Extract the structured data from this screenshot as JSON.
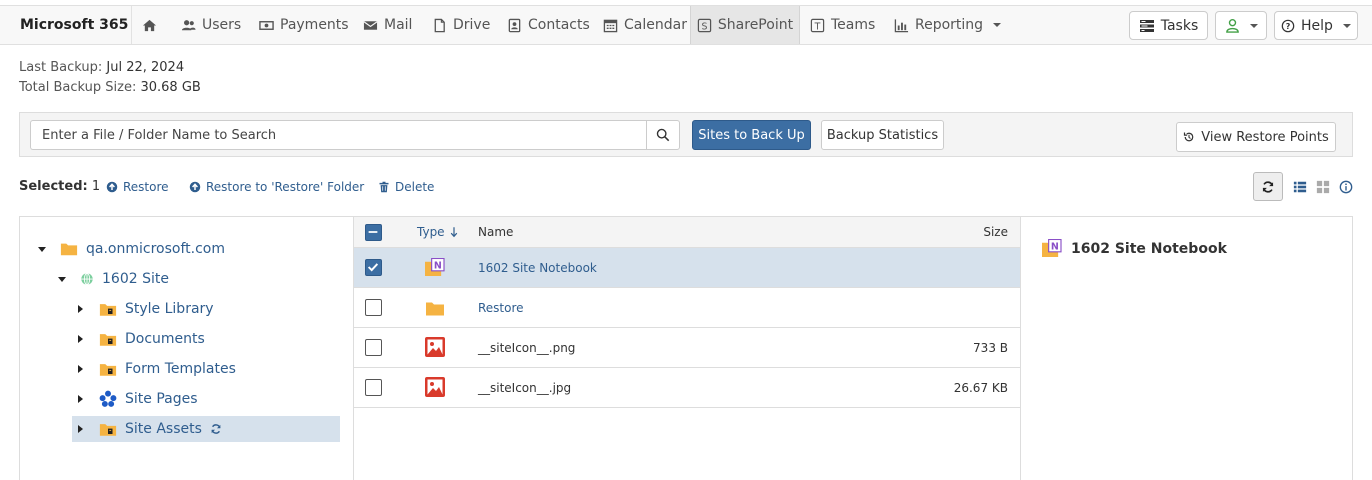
{
  "app": {
    "brand": "Microsoft 365"
  },
  "nav": [
    {
      "label": "",
      "icon": "home-icon"
    },
    {
      "label": "Users",
      "icon": "users-icon"
    },
    {
      "label": "Payments",
      "icon": "payments-icon"
    },
    {
      "label": "Mail",
      "icon": "mail-icon"
    },
    {
      "label": "Drive",
      "icon": "drive-icon"
    },
    {
      "label": "Contacts",
      "icon": "contacts-icon"
    },
    {
      "label": "Calendar",
      "icon": "calendar-icon"
    },
    {
      "label": "SharePoint",
      "icon": "sharepoint-icon",
      "active": true
    },
    {
      "label": "Teams",
      "icon": "teams-icon"
    },
    {
      "label": "Reporting",
      "icon": "reporting-icon"
    }
  ],
  "right_nav": {
    "tasks": "Tasks",
    "help": "Help"
  },
  "backup_info": {
    "last_backup_label": "Last Backup:",
    "last_backup_value": "Jul 22, 2024",
    "total_size_label": "Total Backup Size:",
    "total_size_value": "30.68 GB"
  },
  "search": {
    "placeholder": "Enter a File / Folder Name to Search",
    "value": ""
  },
  "buttons": {
    "sites_to_back_up": "Sites to Back Up",
    "backup_statistics": "Backup Statistics",
    "view_restore_points": "View Restore Points"
  },
  "actions": {
    "selected_label": "Selected:",
    "selected_count": "1",
    "restore": "Restore",
    "restore_to_folder": "Restore to 'Restore' Folder",
    "delete": "Delete"
  },
  "tree": {
    "root": "qa.onmicrosoft.com",
    "site": "1602 Site",
    "children": [
      "Style Library",
      "Documents",
      "Form Templates",
      "Site Pages",
      "Site Assets"
    ],
    "selected": "Site Assets"
  },
  "grid": {
    "columns": {
      "type": "Type",
      "name": "Name",
      "size": "Size"
    },
    "rows": [
      {
        "name": "1602 Site Notebook",
        "size": "",
        "type": "onenote-notebook",
        "checked": true
      },
      {
        "name": "Restore",
        "size": "",
        "type": "folder",
        "checked": false
      },
      {
        "name": "__siteIcon__.png",
        "size": "733 B",
        "type": "image",
        "checked": false
      },
      {
        "name": "__siteIcon__.jpg",
        "size": "26.67 KB",
        "type": "image",
        "checked": false
      }
    ]
  },
  "details": {
    "title": "1602 Site Notebook"
  },
  "colors": {
    "primary": "#3c6ea3",
    "link": "#2f5d8e",
    "selected_row": "#d6e1ec",
    "folder": "#f5b342",
    "image": "#d93a2b",
    "onenote": "#8a4fc7"
  }
}
